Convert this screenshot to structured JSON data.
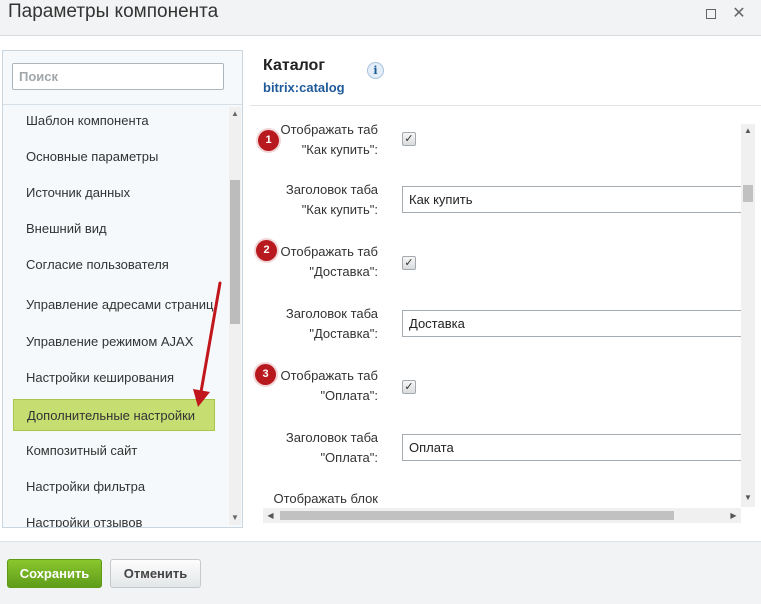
{
  "window": {
    "title": "Параметры компонента"
  },
  "sidebar": {
    "search_placeholder": "Поиск",
    "items": [
      {
        "label": "Шаблон компонента"
      },
      {
        "label": "Основные параметры"
      },
      {
        "label": "Источник данных"
      },
      {
        "label": "Внешний вид"
      },
      {
        "label": "Согласие пользователя"
      },
      {
        "label": "Управление адресами страниц"
      },
      {
        "label": "Управление режимом AJAX"
      },
      {
        "label": "Настройки кеширования"
      },
      {
        "label": "Дополнительные настройки",
        "active": true
      },
      {
        "label": "Композитный сайт"
      },
      {
        "label": "Настройки фильтра"
      },
      {
        "label": "Настройки отзывов"
      }
    ]
  },
  "component": {
    "title": "Каталог",
    "code": "bitrix:catalog",
    "info_icon": "i"
  },
  "form": {
    "rows": [
      {
        "badge": "1",
        "label_line1": "Отображать таб",
        "label_line2": "\"Как купить\":",
        "type": "checkbox",
        "checked": true
      },
      {
        "label_line1": "Заголовок таба",
        "label_line2": "\"Как купить\":",
        "type": "text",
        "value": "Как купить"
      },
      {
        "badge": "2",
        "label_line1": "Отображать таб",
        "label_line2": "\"Доставка\":",
        "type": "checkbox",
        "checked": true
      },
      {
        "label_line1": "Заголовок таба",
        "label_line2": "\"Доставка\":",
        "type": "text",
        "value": "Доставка"
      },
      {
        "badge": "3",
        "label_line1": "Отображать таб",
        "label_line2": "\"Оплата\":",
        "type": "checkbox",
        "checked": true
      },
      {
        "label_line1": "Заголовок таба",
        "label_line2": "\"Оплата\":",
        "type": "text",
        "value": "Оплата"
      },
      {
        "label_line1": "Отображать блок"
      }
    ],
    "check_glyph": "✓"
  },
  "footer": {
    "save_label": "Сохранить",
    "cancel_label": "Отменить"
  },
  "icons": {
    "maximize": "maximize-icon",
    "close": "close-icon",
    "close_glyph": "✕",
    "arrow_up": "▲",
    "arrow_down": "▼",
    "arrow_left": "◀",
    "arrow_right": "▶"
  },
  "colors": {
    "badge": "#b8191f",
    "active_item": "#c5dd71",
    "save_button": "#6fae20",
    "annotation_arrow": "#c0161c"
  }
}
